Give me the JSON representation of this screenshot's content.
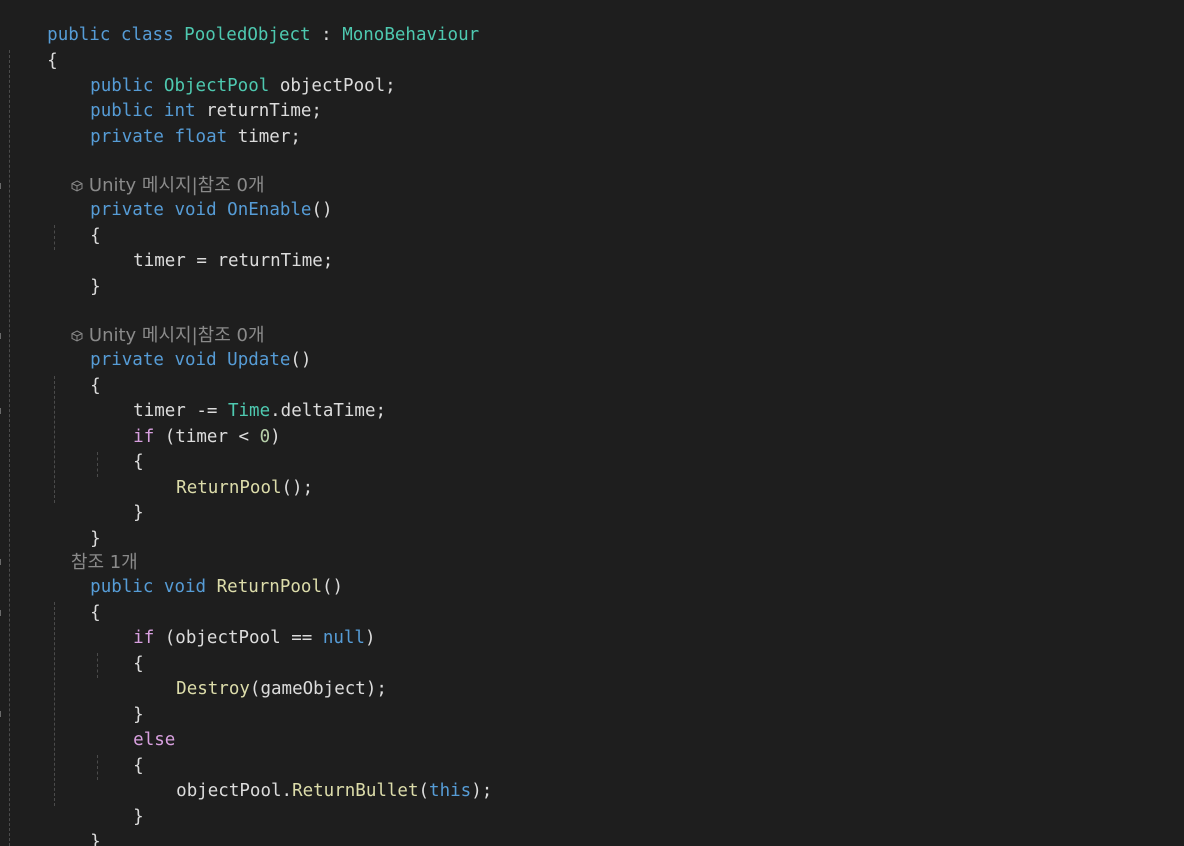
{
  "code_lines": {
    "l1": {
      "a": "public",
      "b": " ",
      "c": "class",
      "d": " ",
      "e": "PooledObject",
      "f": " : ",
      "g": "MonoBehaviour"
    },
    "l2": {
      "a": "{"
    },
    "l3": {
      "a": "public",
      "b": " ",
      "c": "ObjectPool",
      "d": " objectPool;"
    },
    "l4": {
      "a": "public",
      "b": " ",
      "c": "int",
      "d": " returnTime;"
    },
    "l5": {
      "a": "private",
      "b": " ",
      "c": "float",
      "d": " timer;"
    },
    "l6": {
      "a": "private",
      "b": " ",
      "c": "void",
      "d": " ",
      "e": "OnEnable",
      "f": "()"
    },
    "l7": {
      "a": "{"
    },
    "l8": {
      "a": "timer = returnTime;"
    },
    "l9": {
      "a": "}"
    },
    "l10": {
      "a": "private",
      "b": " ",
      "c": "void",
      "d": " ",
      "e": "Update",
      "f": "()"
    },
    "l11": {
      "a": "{"
    },
    "l12": {
      "a": "timer -= ",
      "b": "Time",
      "c": ".deltaTime;"
    },
    "l13": {
      "a": "if",
      "b": " (timer < ",
      "c": "0",
      "d": ")"
    },
    "l14": {
      "a": "{"
    },
    "l15": {
      "a": "ReturnPool",
      "b": "();"
    },
    "l16": {
      "a": "}"
    },
    "l17": {
      "a": "}"
    },
    "l18": {
      "a": "public",
      "b": " ",
      "c": "void",
      "d": " ",
      "e": "ReturnPool",
      "f": "()"
    },
    "l19": {
      "a": "{"
    },
    "l20": {
      "a": "if",
      "b": " (objectPool == ",
      "c": "null",
      "d": ")"
    },
    "l21": {
      "a": "{"
    },
    "l22": {
      "a": "Destroy",
      "b": "(gameObject);"
    },
    "l23": {
      "a": "}"
    },
    "l24": {
      "a": "else"
    },
    "l25": {
      "a": "{"
    },
    "l26": {
      "a": "objectPool.",
      "b": "ReturnBullet",
      "c": "(",
      "d": "this",
      "e": ");"
    },
    "l27": {
      "a": "}"
    },
    "l28": {
      "a": "}"
    }
  },
  "codelens": {
    "unity_label": "Unity 메시지",
    "separator": "|",
    "refs_zero": "참조 0개",
    "refs_one": "참조 1개",
    "icon": "unity-cube-icon"
  },
  "colors": {
    "background": "#1e1e1e",
    "keyword": "#569cd6",
    "control": "#d8a0df",
    "type": "#4ec9b0",
    "method": "#dcdcaa",
    "number": "#b5cea8",
    "text": "#dcdcdc",
    "codelens": "#8a8a8a"
  }
}
